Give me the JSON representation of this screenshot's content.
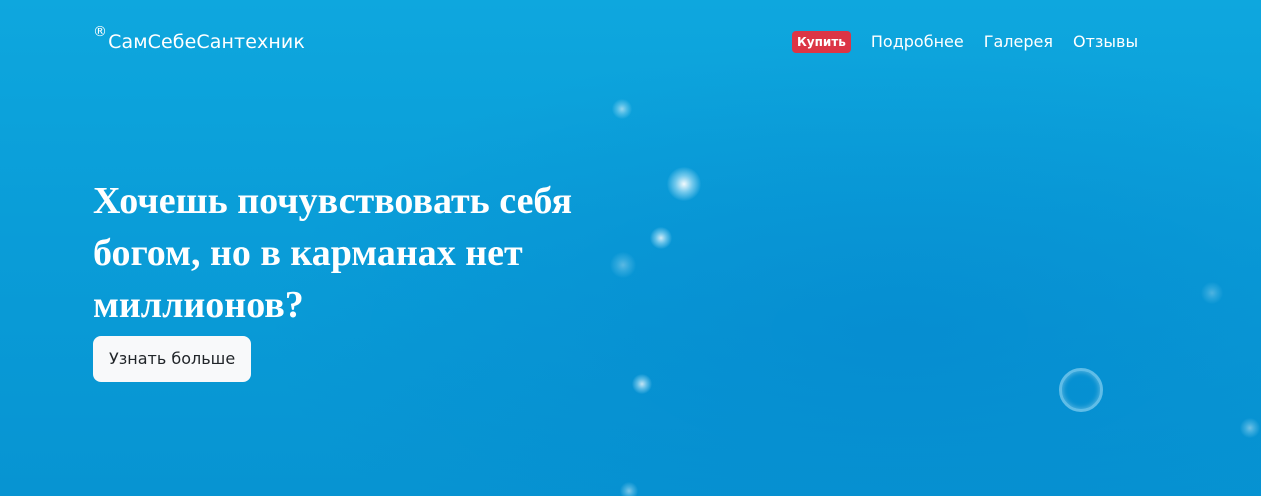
{
  "brand": {
    "mark": "®",
    "name": "СамСебеСантехник"
  },
  "nav": {
    "buy_label": "Купить",
    "links": [
      "Подробнее",
      "Галерея",
      "Отзывы"
    ]
  },
  "hero": {
    "headline": "Хочешь почувствовать себя богом, но в карманах нет миллионов?",
    "cta_label": "Узнать больше"
  },
  "colors": {
    "background": "#0a9dd8",
    "buy_badge": "#dc3545",
    "cta_background": "#f8f9fa",
    "text": "#ffffff"
  }
}
